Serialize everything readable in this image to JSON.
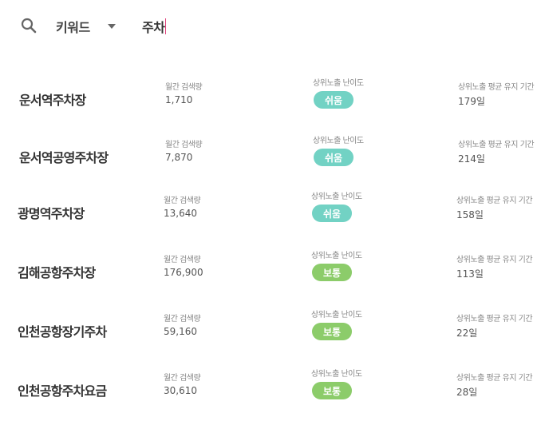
{
  "search": {
    "icon": "search-icon",
    "select_label": "키워드",
    "query": "주차"
  },
  "labels": {
    "monthly": "월간 검색량",
    "difficulty": "상위노출 난이도",
    "duration": "상위노출 평균 유지 기간"
  },
  "colors": {
    "easy": "#72d2c4",
    "normal": "#8ccc6a"
  },
  "rows": [
    {
      "keyword": "운서역주차장",
      "monthly": "1,710",
      "difficulty": "쉬움",
      "level": "easy",
      "duration": "179일"
    },
    {
      "keyword": "운서역공영주차장",
      "monthly": "7,870",
      "difficulty": "쉬움",
      "level": "easy",
      "duration": "214일"
    },
    {
      "keyword": "광명역주차장",
      "monthly": "13,640",
      "difficulty": "쉬움",
      "level": "easy",
      "duration": "158일"
    },
    {
      "keyword": "김해공항주차장",
      "monthly": "176,900",
      "difficulty": "보통",
      "level": "normal",
      "duration": "113일"
    },
    {
      "keyword": "인천공항장기주차",
      "monthly": "59,160",
      "difficulty": "보통",
      "level": "normal",
      "duration": "22일"
    },
    {
      "keyword": "인천공항주차요금",
      "monthly": "30,610",
      "difficulty": "보통",
      "level": "normal",
      "duration": "28일"
    }
  ]
}
